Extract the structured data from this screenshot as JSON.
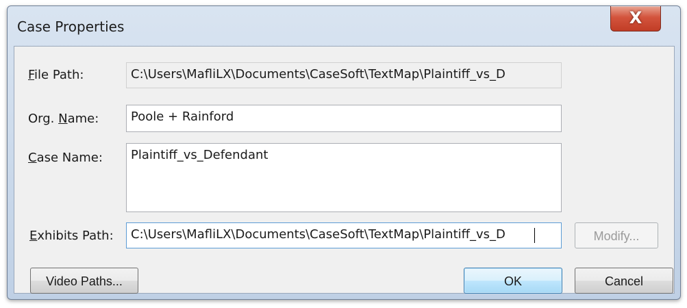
{
  "window": {
    "title": "Case Properties",
    "close_label": "X"
  },
  "form": {
    "file_path": {
      "label_hotkey": "F",
      "label_rest": "ile Path:",
      "value": "C:\\Users\\MafliLX\\Documents\\CaseSoft\\TextMap\\Plaintiff_vs_D"
    },
    "org_name": {
      "label_pre": "Org. ",
      "label_hotkey": "N",
      "label_rest": "ame:",
      "value": "Poole + Rainford"
    },
    "case_name": {
      "label_hotkey": "C",
      "label_rest": "ase Name:",
      "value": "Plaintiff_vs_Defendant"
    },
    "exhibits_path": {
      "label_hotkey": "E",
      "label_rest": "xhibits Path:",
      "value": "C:\\Users\\MafliLX\\Documents\\CaseSoft\\TextMap\\Plaintiff_vs_D"
    }
  },
  "buttons": {
    "modify": "Modify...",
    "video_paths": "Video Paths...",
    "ok": "OK",
    "cancel": "Cancel"
  }
}
